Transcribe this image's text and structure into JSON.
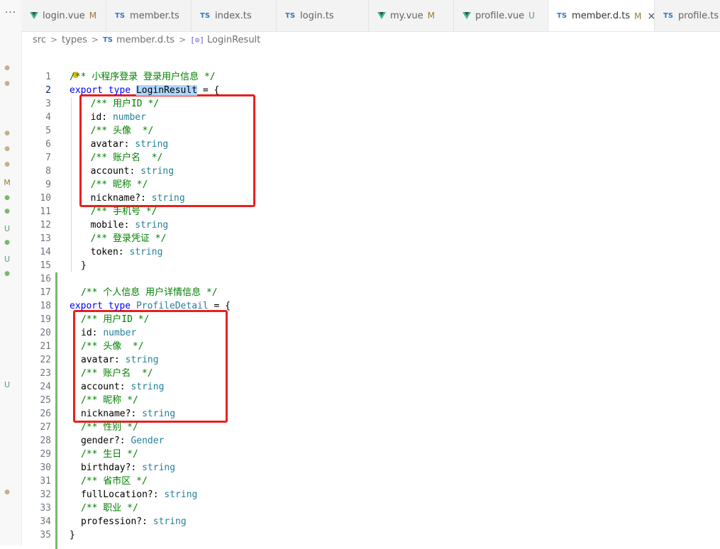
{
  "window": {
    "overflow_label": "···"
  },
  "tabs": [
    {
      "label": "login.vue",
      "icon": "vue-icon",
      "badge": "M",
      "active": false
    },
    {
      "label": "member.ts",
      "icon": "ts-icon",
      "badge": "",
      "active": false
    },
    {
      "label": "index.ts",
      "icon": "ts-icon",
      "badge": "",
      "active": false
    },
    {
      "label": "login.ts",
      "icon": "ts-icon",
      "badge": "",
      "active": false
    },
    {
      "label": "my.vue",
      "icon": "vue-icon",
      "badge": "M",
      "active": false
    },
    {
      "label": "profile.vue",
      "icon": "vue-icon",
      "badge": "U",
      "active": false
    },
    {
      "label": "member.d.ts",
      "icon": "ts-icon",
      "badge": "M",
      "active": true
    },
    {
      "label": "profile.ts",
      "icon": "ts-icon",
      "badge": "U",
      "active": false
    }
  ],
  "tab_icon_text": {
    "ts": "TS",
    "close": "×"
  },
  "breadcrumb": {
    "parts": [
      "src",
      "types",
      "member.d.ts",
      "LoginResult"
    ],
    "separator": ">",
    "symbol_icon": "[⊙]"
  },
  "scm_markers": [
    {
      "type": "dot",
      "color": "#c4b28c"
    },
    {
      "type": "dot",
      "color": "#c4b28c"
    },
    {
      "type": "dot",
      "color": "#c4b28c"
    },
    {
      "type": "dot",
      "color": "#c4b28c"
    },
    {
      "type": "dot",
      "color": "#c4b28c"
    },
    {
      "type": "text",
      "label": "M",
      "color": "#9a7a36"
    },
    {
      "type": "dot",
      "color": "#7ab86e"
    },
    {
      "type": "dot",
      "color": "#7ab86e"
    },
    {
      "type": "text",
      "label": "U",
      "color": "#58a06b"
    },
    {
      "type": "dot",
      "color": "#7ab86e"
    },
    {
      "type": "text",
      "label": "U",
      "color": "#58a06b"
    },
    {
      "type": "dot",
      "color": "#7ab86e"
    },
    {
      "type": "text",
      "label": "U",
      "color": "#58a06b"
    },
    {
      "type": "dot",
      "color": "#c4b28c"
    }
  ],
  "editor": {
    "current_line": 2,
    "lines": [
      {
        "n": 1,
        "tokens": [
          [
            "cm",
            "/** 小程序登录 登录用户信息 */"
          ]
        ]
      },
      {
        "n": 2,
        "tokens": [
          [
            "kw",
            "export"
          ],
          [
            "pl",
            " "
          ],
          [
            "kw",
            "type"
          ],
          [
            "pl",
            " "
          ],
          [
            "hl",
            "LoginResult"
          ],
          [
            "pl",
            " = {"
          ]
        ]
      },
      {
        "n": 3,
        "tokens": [
          [
            "pl",
            "  "
          ],
          [
            "cm",
            "/** 用户ID */"
          ]
        ]
      },
      {
        "n": 4,
        "tokens": [
          [
            "pl",
            "  id: "
          ],
          [
            "ty",
            "number"
          ]
        ]
      },
      {
        "n": 5,
        "tokens": [
          [
            "pl",
            "  "
          ],
          [
            "cm",
            "/** 头像  */"
          ]
        ]
      },
      {
        "n": 6,
        "tokens": [
          [
            "pl",
            "  avatar: "
          ],
          [
            "ty",
            "string"
          ]
        ]
      },
      {
        "n": 7,
        "tokens": [
          [
            "pl",
            "  "
          ],
          [
            "cm",
            "/** 账户名  */"
          ]
        ]
      },
      {
        "n": 8,
        "tokens": [
          [
            "pl",
            "  account: "
          ],
          [
            "ty",
            "string"
          ]
        ]
      },
      {
        "n": 9,
        "tokens": [
          [
            "pl",
            "  "
          ],
          [
            "cm",
            "/** 昵称 */"
          ]
        ]
      },
      {
        "n": 10,
        "tokens": [
          [
            "pl",
            "  nickname?: "
          ],
          [
            "ty",
            "string"
          ]
        ]
      },
      {
        "n": 11,
        "tokens": [
          [
            "pl",
            "  "
          ],
          [
            "cm",
            "/** 手机号 */"
          ]
        ]
      },
      {
        "n": 12,
        "tokens": [
          [
            "pl",
            "  mobile: "
          ],
          [
            "ty",
            "string"
          ]
        ]
      },
      {
        "n": 13,
        "tokens": [
          [
            "pl",
            "  "
          ],
          [
            "cm",
            "/** 登录凭证 */"
          ]
        ]
      },
      {
        "n": 14,
        "tokens": [
          [
            "pl",
            "  token: "
          ],
          [
            "ty",
            "string"
          ]
        ]
      },
      {
        "n": 15,
        "tokens": [
          [
            "pl",
            "}"
          ]
        ]
      },
      {
        "n": 16,
        "tokens": []
      },
      {
        "n": 17,
        "tokens": [
          [
            "cm",
            "/** 个人信息 用户详情信息 */"
          ]
        ]
      },
      {
        "n": 18,
        "tokens": [
          [
            "kw",
            "export"
          ],
          [
            "pl",
            " "
          ],
          [
            "kw",
            "type"
          ],
          [
            "pl",
            " "
          ],
          [
            "ty",
            "ProfileDetail"
          ],
          [
            "pl",
            " = {"
          ]
        ]
      },
      {
        "n": 19,
        "tokens": [
          [
            "cm",
            "/** 用户ID */"
          ]
        ]
      },
      {
        "n": 20,
        "tokens": [
          [
            "pl",
            "id: "
          ],
          [
            "ty",
            "number"
          ]
        ]
      },
      {
        "n": 21,
        "tokens": [
          [
            "cm",
            "/** 头像  */"
          ]
        ]
      },
      {
        "n": 22,
        "tokens": [
          [
            "pl",
            "avatar: "
          ],
          [
            "ty",
            "string"
          ]
        ]
      },
      {
        "n": 23,
        "tokens": [
          [
            "cm",
            "/** 账户名  */"
          ]
        ]
      },
      {
        "n": 24,
        "tokens": [
          [
            "pl",
            "account: "
          ],
          [
            "ty",
            "string"
          ]
        ]
      },
      {
        "n": 25,
        "tokens": [
          [
            "cm",
            "/** 昵称 */"
          ]
        ]
      },
      {
        "n": 26,
        "tokens": [
          [
            "pl",
            "nickname?: "
          ],
          [
            "ty",
            "string"
          ]
        ]
      },
      {
        "n": 27,
        "tokens": [
          [
            "cm",
            "/** 性别 */"
          ]
        ]
      },
      {
        "n": 28,
        "tokens": [
          [
            "pl",
            "gender?: "
          ],
          [
            "ty",
            "Gender"
          ]
        ]
      },
      {
        "n": 29,
        "tokens": [
          [
            "cm",
            "/** 生日 */"
          ]
        ]
      },
      {
        "n": 30,
        "tokens": [
          [
            "pl",
            "birthday?: "
          ],
          [
            "ty",
            "string"
          ]
        ]
      },
      {
        "n": 31,
        "tokens": [
          [
            "cm",
            "/** 省市区 */"
          ]
        ]
      },
      {
        "n": 32,
        "tokens": [
          [
            "pl",
            "fullLocation?: "
          ],
          [
            "ty",
            "string"
          ]
        ]
      },
      {
        "n": 33,
        "tokens": [
          [
            "cm",
            "/** 职业 */"
          ]
        ]
      },
      {
        "n": 34,
        "tokens": [
          [
            "pl",
            "profession?: "
          ],
          [
            "ty",
            "string"
          ]
        ]
      },
      {
        "n": 35,
        "tokens": [
          [
            "pl",
            "}"
          ]
        ]
      }
    ]
  },
  "colors": {
    "comment": "#008000",
    "keyword": "#0000ff",
    "type": "#267f99",
    "highlight": "#add6ff",
    "annotation": "#e82020"
  }
}
